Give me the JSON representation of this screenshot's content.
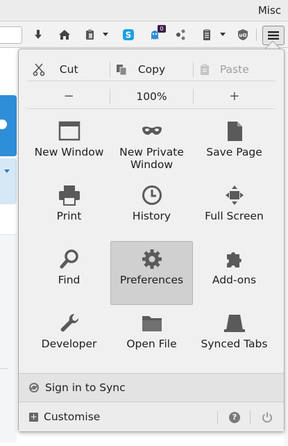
{
  "titlebar": {
    "title": "Misc"
  },
  "navbar": {
    "buttons": [
      {
        "icon": "download-icon"
      },
      {
        "icon": "home-icon"
      },
      {
        "icon": "clipboard-icon"
      },
      {
        "icon": "skype-icon"
      },
      {
        "icon": "ghostery-icon",
        "badge": "0"
      },
      {
        "icon": "share-icon"
      },
      {
        "icon": "clipboard-list-icon"
      },
      {
        "icon": "ublock-icon"
      },
      {
        "icon": "hamburger-menu-icon"
      }
    ]
  },
  "menu": {
    "edit": {
      "cut": "Cut",
      "copy": "Copy",
      "paste": "Paste"
    },
    "zoom": {
      "minus": "−",
      "level": "100%",
      "plus": "+"
    },
    "items": [
      {
        "label": "New Window",
        "icon": "window-icon"
      },
      {
        "label": "New Private\nWindow",
        "icon": "mask-icon"
      },
      {
        "label": "Save Page",
        "icon": "document-icon"
      },
      {
        "label": "Print",
        "icon": "printer-icon"
      },
      {
        "label": "History",
        "icon": "clock-icon"
      },
      {
        "label": "Full Screen",
        "icon": "fullscreen-icon"
      },
      {
        "label": "Find",
        "icon": "magnifier-icon"
      },
      {
        "label": "Preferences",
        "icon": "gear-icon"
      },
      {
        "label": "Add-ons",
        "icon": "puzzle-icon"
      },
      {
        "label": "Developer",
        "icon": "wrench-icon"
      },
      {
        "label": "Open File",
        "icon": "folder-icon"
      },
      {
        "label": "Synced Tabs",
        "icon": "synced-tabs-icon"
      }
    ],
    "sync": {
      "label": "Sign in to Sync"
    },
    "footer": {
      "customise": "Customise",
      "help": "?"
    }
  },
  "colors": {
    "panel_bg": "#f0f0f0",
    "active_tile": "#d0d0d0",
    "icon": "#5a5a5a",
    "accent_blue": "#2e8ed8"
  }
}
